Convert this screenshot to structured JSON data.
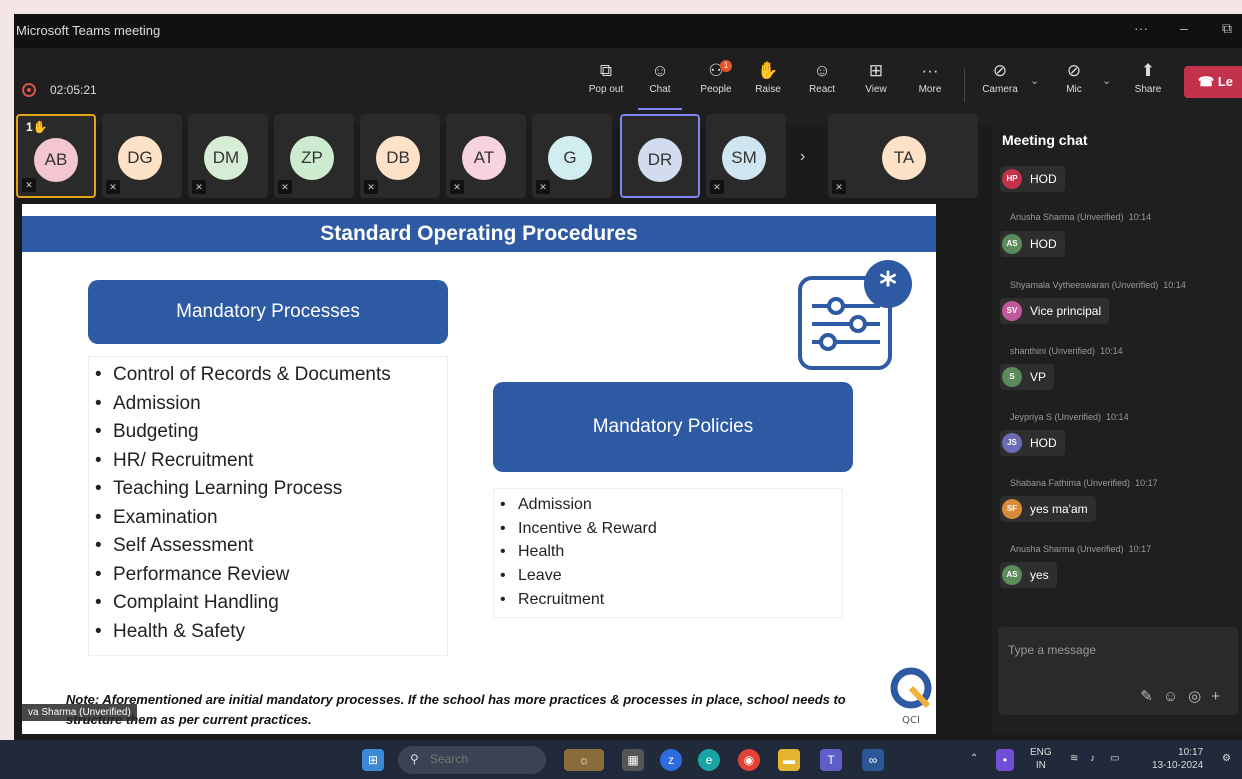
{
  "window": {
    "title": "Microsoft Teams meeting",
    "controls": [
      "···",
      "–",
      "⧉"
    ]
  },
  "toolbar": {
    "timer": "02:05:21",
    "buttons": [
      {
        "label": "Pop out",
        "icon": "popout-icon"
      },
      {
        "label": "Chat",
        "icon": "chat-icon"
      },
      {
        "label": "People",
        "icon": "people-icon",
        "badge": "1"
      },
      {
        "label": "Raise",
        "icon": "raise-hand-icon"
      },
      {
        "label": "React",
        "icon": "smiley-icon"
      },
      {
        "label": "View",
        "icon": "grid-icon"
      },
      {
        "label": "More",
        "icon": "more-icon"
      }
    ],
    "devices": [
      {
        "label": "Camera",
        "icon": "camera-off-icon"
      },
      {
        "label": "Mic",
        "icon": "mic-off-icon"
      },
      {
        "label": "Share",
        "icon": "share-icon"
      }
    ],
    "leave": "Le"
  },
  "participants": [
    {
      "initials": "AB",
      "color": "#f4c6cf",
      "hand": "1"
    },
    {
      "initials": "DG",
      "color": "#fde2c8"
    },
    {
      "initials": "DM",
      "color": "#d6ecd4"
    },
    {
      "initials": "ZP",
      "color": "#cdebcf"
    },
    {
      "initials": "DB",
      "color": "#fde2c8"
    },
    {
      "initials": "AT",
      "color": "#f7d3de"
    },
    {
      "initials": "G",
      "color": "#d2edf0"
    },
    {
      "initials": "DR",
      "color": "#d3dcef"
    },
    {
      "initials": "SM",
      "color": "#cfe6f1"
    },
    {
      "initials": "TA",
      "color": "#fde2c8"
    }
  ],
  "slide": {
    "title": "Standard Operating Procedures",
    "processes_heading": "Mandatory Processes",
    "processes": [
      "Control of Records & Documents",
      "Admission",
      "Budgeting",
      "HR/ Recruitment",
      "Teaching Learning Process",
      "Examination",
      "Self Assessment",
      "Performance Review",
      "Complaint Handling",
      "Health & Safety"
    ],
    "policies_heading": "Mandatory Policies",
    "policies": [
      "Admission",
      "Incentive & Reward",
      "Health",
      "Leave",
      "Recruitment"
    ],
    "note": "Note: Aforementioned are initial mandatory processes. If the school has more practices & processes in place, school needs to structure them as per current practices.",
    "logo_text": "QCI",
    "presenter_tag": "va Sharma (Unverified)"
  },
  "chat": {
    "title": "Meeting chat",
    "messages": [
      {
        "sender": "",
        "time": "",
        "initials": "HP",
        "color": "#c4314b",
        "text": "HOD"
      },
      {
        "sender": "Anusha Sharma (Unverified)",
        "time": "10:14",
        "initials": "AS",
        "color": "#5b8a5b",
        "text": "HOD"
      },
      {
        "sender": "Shyamala Vytheeswaran (Unverified)",
        "time": "10:14",
        "initials": "SV",
        "color": "#c2579b",
        "text": "Vice principal"
      },
      {
        "sender": "shanthini (Unverified)",
        "time": "10:14",
        "initials": "S",
        "color": "#5b8a5b",
        "text": "VP"
      },
      {
        "sender": "Jeypriya S (Unverified)",
        "time": "10:14",
        "initials": "JS",
        "color": "#6b6bb5",
        "text": "HOD"
      },
      {
        "sender": "Shabana Fathima (Unverified)",
        "time": "10:17",
        "initials": "SF",
        "color": "#d98b3a",
        "text": "yes ma'am"
      },
      {
        "sender": "Anusha Sharma (Unverified)",
        "time": "10:17",
        "initials": "AS",
        "color": "#5b8a5b",
        "text": "yes"
      }
    ],
    "compose_placeholder": "Type a message"
  },
  "taskbar": {
    "search_placeholder": "Search",
    "lang_top": "ENG",
    "lang_bottom": "IN",
    "time": "10:17",
    "date": "13-10-2024"
  }
}
